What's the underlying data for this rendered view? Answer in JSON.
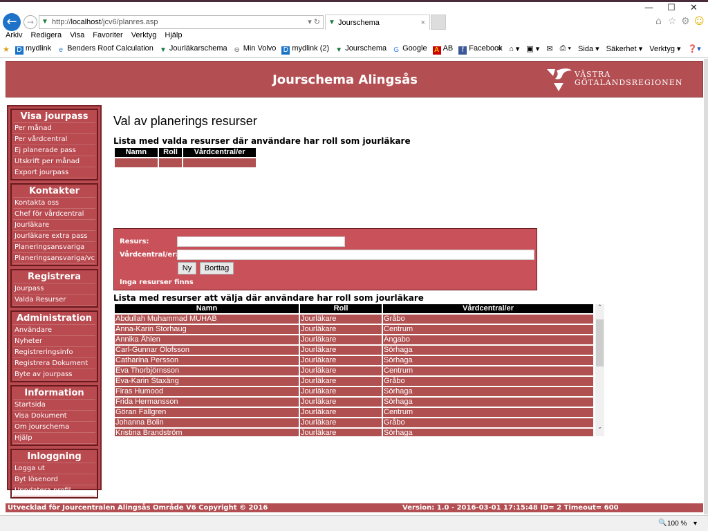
{
  "browser": {
    "url_prefix": "http://",
    "url_host": "localhost",
    "url_path": "/jcv6/planres.asp",
    "tab_title": "Jourschema",
    "menu": [
      "Arkiv",
      "Redigera",
      "Visa",
      "Favoriter",
      "Verktyg",
      "Hjälp"
    ],
    "favorites": [
      "mydlink",
      "Benders Roof Calculation",
      "Jourläkarschema",
      "Min Volvo",
      "mydlink (2)",
      "Jourschema",
      "Google",
      "AB",
      "Facebook"
    ],
    "commands": [
      "Sida ▾",
      "Säkerhet ▾",
      "Verktyg ▾"
    ],
    "zoom": "100 %"
  },
  "header": {
    "title": "Jourschema Alingsås",
    "logo_line1": "VÄSTRA",
    "logo_line2": "GÖTALANDSREGIONEN"
  },
  "sidebar": [
    {
      "title": "Visa jourpass",
      "items": [
        "Per månad",
        "Per vårdcentral",
        "Ej planerade pass",
        "Utskrift per månad",
        "Export jourpass"
      ]
    },
    {
      "title": "Kontakter",
      "items": [
        "Kontakta oss",
        "Chef för vårdcentral",
        "Jourläkare",
        "Jourläkare extra pass",
        "Planeringsansvariga",
        "Planeringsansvariga/vc"
      ]
    },
    {
      "title": "Registrera",
      "items": [
        "Jourpass",
        "Valda Resurser"
      ]
    },
    {
      "title": "Administration",
      "items": [
        "Användare",
        "Nyheter",
        "Registreringsinfo",
        "Registrera Dokument",
        "Byte av jourpass"
      ]
    },
    {
      "title": "Information",
      "items": [
        "Startsida",
        "Visa Dokument",
        "Om jourschema",
        "Hjälp"
      ]
    },
    {
      "title": "Inloggning",
      "items": [
        "Logga ut",
        "Byt lösenord",
        "Uppdatera profil"
      ]
    }
  ],
  "main": {
    "title": "Val av planerings resurser",
    "selected_heading": "Lista med valda resurser där användare har roll som jourläkare",
    "columns": [
      "Namn",
      "Roll",
      "Vårdcentral/er"
    ],
    "form": {
      "resurs_label": "Resurs:",
      "resurs_value": "",
      "vc_label": "Vårdcentral/er:",
      "vc_value": "",
      "new_button": "Ny",
      "delete_button": "Borttag",
      "message": "Inga resurser finns"
    },
    "available_heading": "Lista med resurser att välja där användare har roll som jourläkare",
    "rows": [
      [
        "Abdullah Muhammad MUHAB",
        "Jourläkare",
        "Gråbo"
      ],
      [
        "Anna-Karin Storhaug",
        "Jourläkare",
        "Centrum"
      ],
      [
        "Annika Åhlen",
        "Jourläkare",
        "Ängabo"
      ],
      [
        "Carl-Gunnar Olofsson",
        "Jourläkare",
        "Sörhaga"
      ],
      [
        "Catharina Persson",
        "Jourläkare",
        "Sörhaga"
      ],
      [
        "Eva Thorbjörnsson",
        "Jourläkare",
        "Centrum"
      ],
      [
        "Eva-Karin Staxäng",
        "Jourläkare",
        "Gråbo"
      ],
      [
        "Firas Humood",
        "Jourläkare",
        "Sörhaga"
      ],
      [
        "Frida Hermansson",
        "Jourläkare",
        "Sörhaga"
      ],
      [
        "Göran Fällgren",
        "Jourläkare",
        "Centrum"
      ],
      [
        "Johanna Bolin",
        "Jourläkare",
        "Gråbo"
      ],
      [
        "Kristina Brandström",
        "Jourläkare",
        "Sörhaga"
      ]
    ]
  },
  "footer": {
    "left": "Utvecklad för Jourcentralen Alingsås Område V6 Copyright © 2016",
    "right": "Version: 1.0 - 2016-03-01 17:15:48 ID= 2 Timeout= 600"
  },
  "colors": {
    "brand": "#b34f53",
    "form_bg": "#c9525a",
    "row_bg": "#b05050"
  }
}
